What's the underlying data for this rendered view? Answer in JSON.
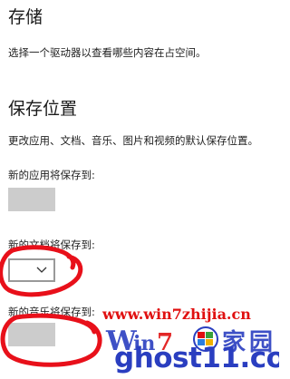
{
  "storage": {
    "title": "存储",
    "description": "选择一个驱动器以查看哪些内容在占空间。"
  },
  "save_locations": {
    "title": "保存位置",
    "description": "更改应用、文档、音乐、图片和视频的默认保存位置。",
    "apps_label": "新的应用将保存到:",
    "docs_label": "新的文档将保存到:",
    "music_label": "新的音乐将保存到:"
  },
  "watermark": {
    "site": "www.win7zhijia.cn",
    "ghost": "ghost11.com"
  },
  "colors": {
    "annotation": "#e8101a",
    "watermark_red": "#e01010",
    "watermark_blue": "#2a3ec0",
    "dropdown_disabled": "#cccccc"
  }
}
